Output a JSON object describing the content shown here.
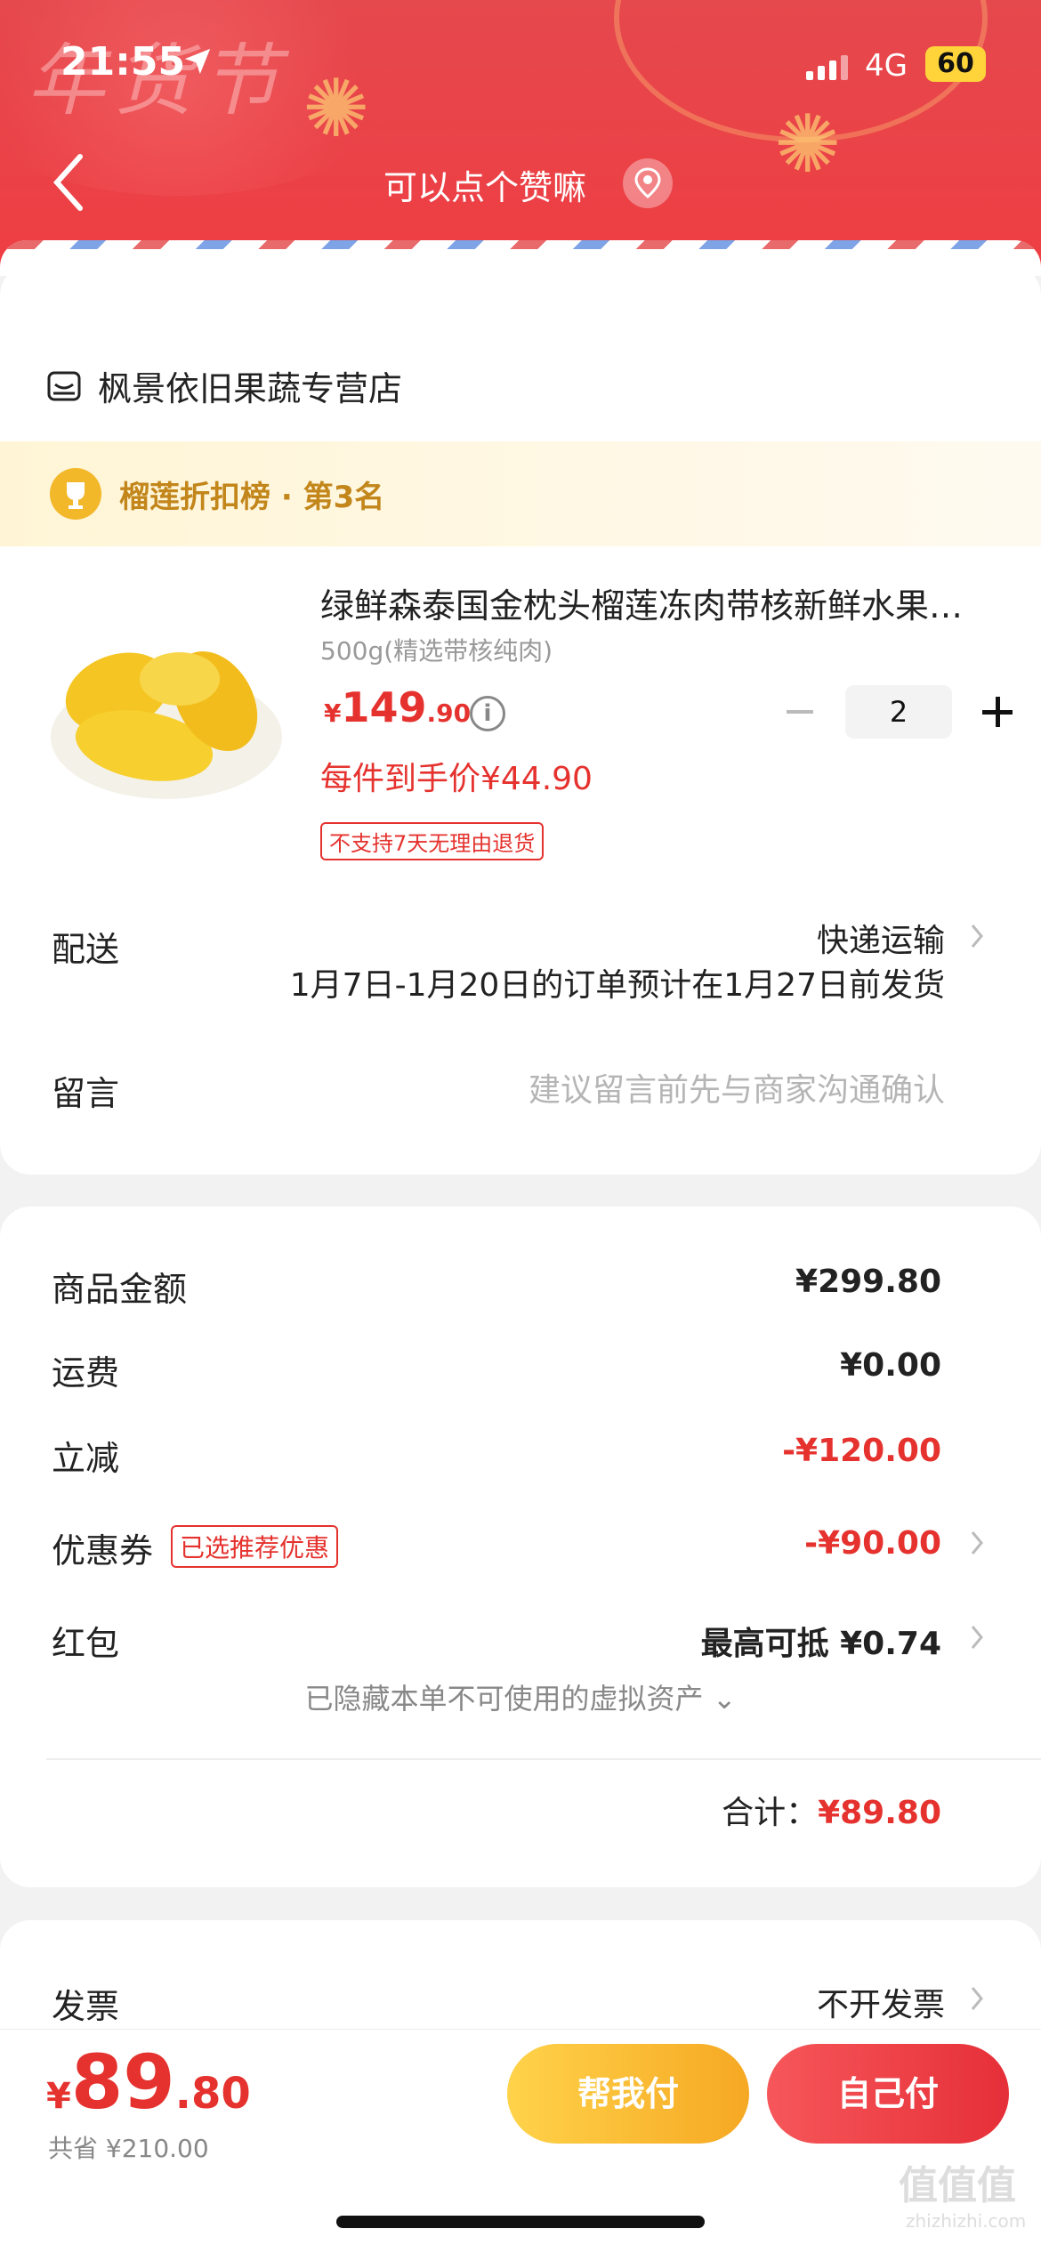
{
  "status_bar": {
    "time": "21:55",
    "network": "4G",
    "battery": "60"
  },
  "header": {
    "title": "可以点个赞嘛",
    "festival_text": "年货节"
  },
  "shop": {
    "name": "枫景依旧果蔬专营店"
  },
  "ranking": {
    "text": "榴莲折扣榜 · 第3名"
  },
  "product": {
    "title": "绿鲜森泰国金枕头榴莲冻肉带核新鲜水果…",
    "spec": "500g(精选带核纯肉)",
    "price_currency": "¥",
    "price_int": "149",
    "price_dec": ".90",
    "per_item_price": "每件到手价¥44.90",
    "no_return_tag": "不支持7天无理由退货",
    "quantity": "2"
  },
  "delivery": {
    "label": "配送",
    "method": "快递运输",
    "note": "1月7日-1月20日的订单预计在1月27日前发货"
  },
  "message": {
    "label": "留言",
    "placeholder": "建议留言前先与商家沟通确认"
  },
  "summary": {
    "goods_label": "商品金额",
    "goods_value": "¥299.80",
    "shipping_label": "运费",
    "shipping_value": "¥0.00",
    "discount_label": "立减",
    "discount_value": "-¥120.00",
    "coupon_label": "优惠券",
    "coupon_badge": "已选推荐优惠",
    "coupon_value": "-¥90.00",
    "redpacket_label": "红包",
    "redpacket_value": "最高可抵 ¥0.74",
    "hidden_assets": "已隐藏本单不可使用的虚拟资产",
    "total_label": "合计：",
    "total_value": "¥89.80"
  },
  "invoice": {
    "label": "发票",
    "value": "不开发票"
  },
  "bottom": {
    "pay_currency": "¥",
    "pay_int": "89",
    "pay_dec": ".80",
    "saved": "共省 ¥210.00",
    "help_pay": "帮我付",
    "self_pay": "自己付"
  },
  "watermark": {
    "main": "值值值",
    "sub": "zhizhizhi.com"
  },
  "colors": {
    "accent_red": "#e5322e",
    "header_red": "#ee3e43",
    "help_yellow": "#f6a823",
    "rank_gold": "#c2861b"
  }
}
